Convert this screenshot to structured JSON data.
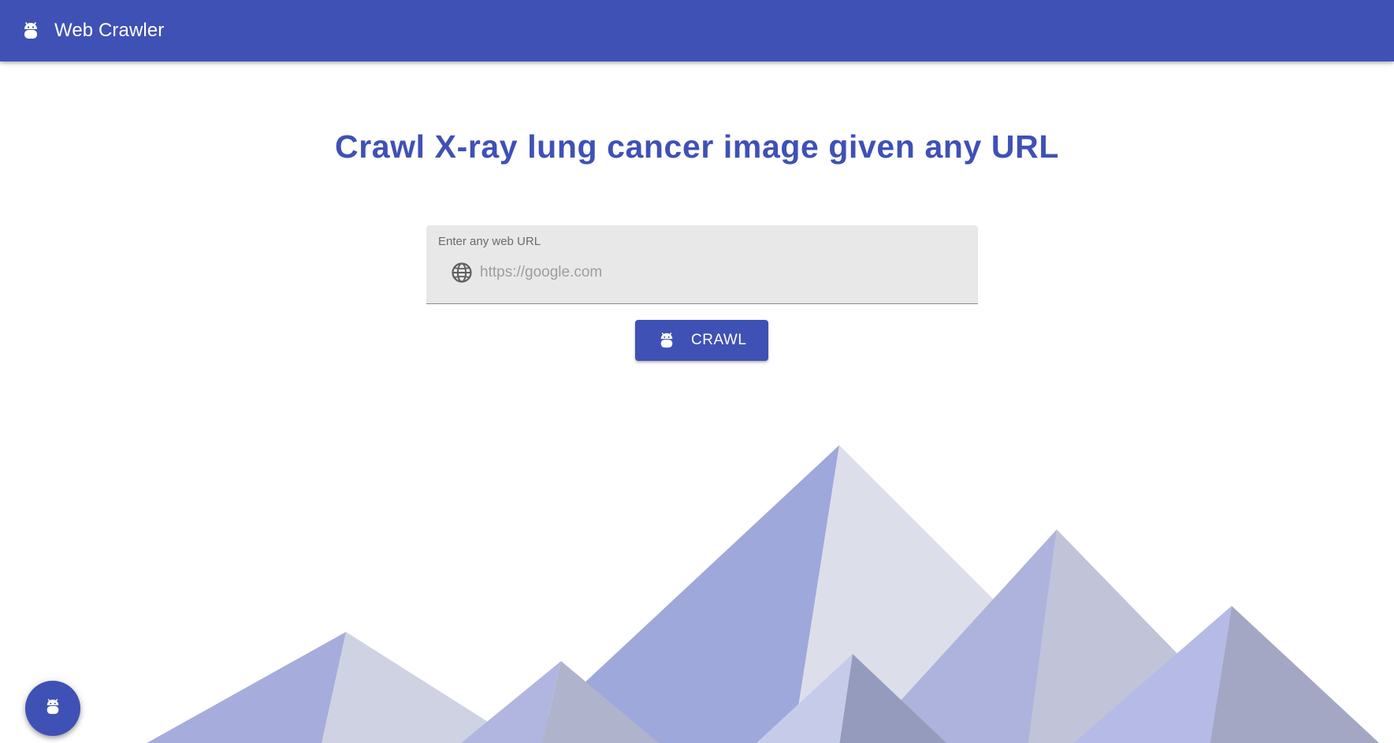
{
  "theme": {
    "primary": "#3f51b5",
    "mountain_colors": [
      "#9fa8da",
      "#dcdfea",
      "#aeb3de",
      "#c1c3d8",
      "#b5bbe6",
      "#a4a7c4",
      "#c6cbea",
      "#959bbd",
      "#a6acdc",
      "#cfd2e2",
      "#b1b6e0",
      "#b0b3cc"
    ]
  },
  "app_bar": {
    "title": "Web Crawler",
    "icon": "android-icon"
  },
  "main": {
    "headline": "Crawl X-ray lung cancer image given any URL",
    "url_field": {
      "label": "Enter any web URL",
      "placeholder": "https://google.com",
      "value": "",
      "icon": "globe-icon"
    },
    "crawl_button": {
      "label": "CRAWL",
      "icon": "android-icon"
    }
  },
  "fab": {
    "icon": "android-icon"
  }
}
